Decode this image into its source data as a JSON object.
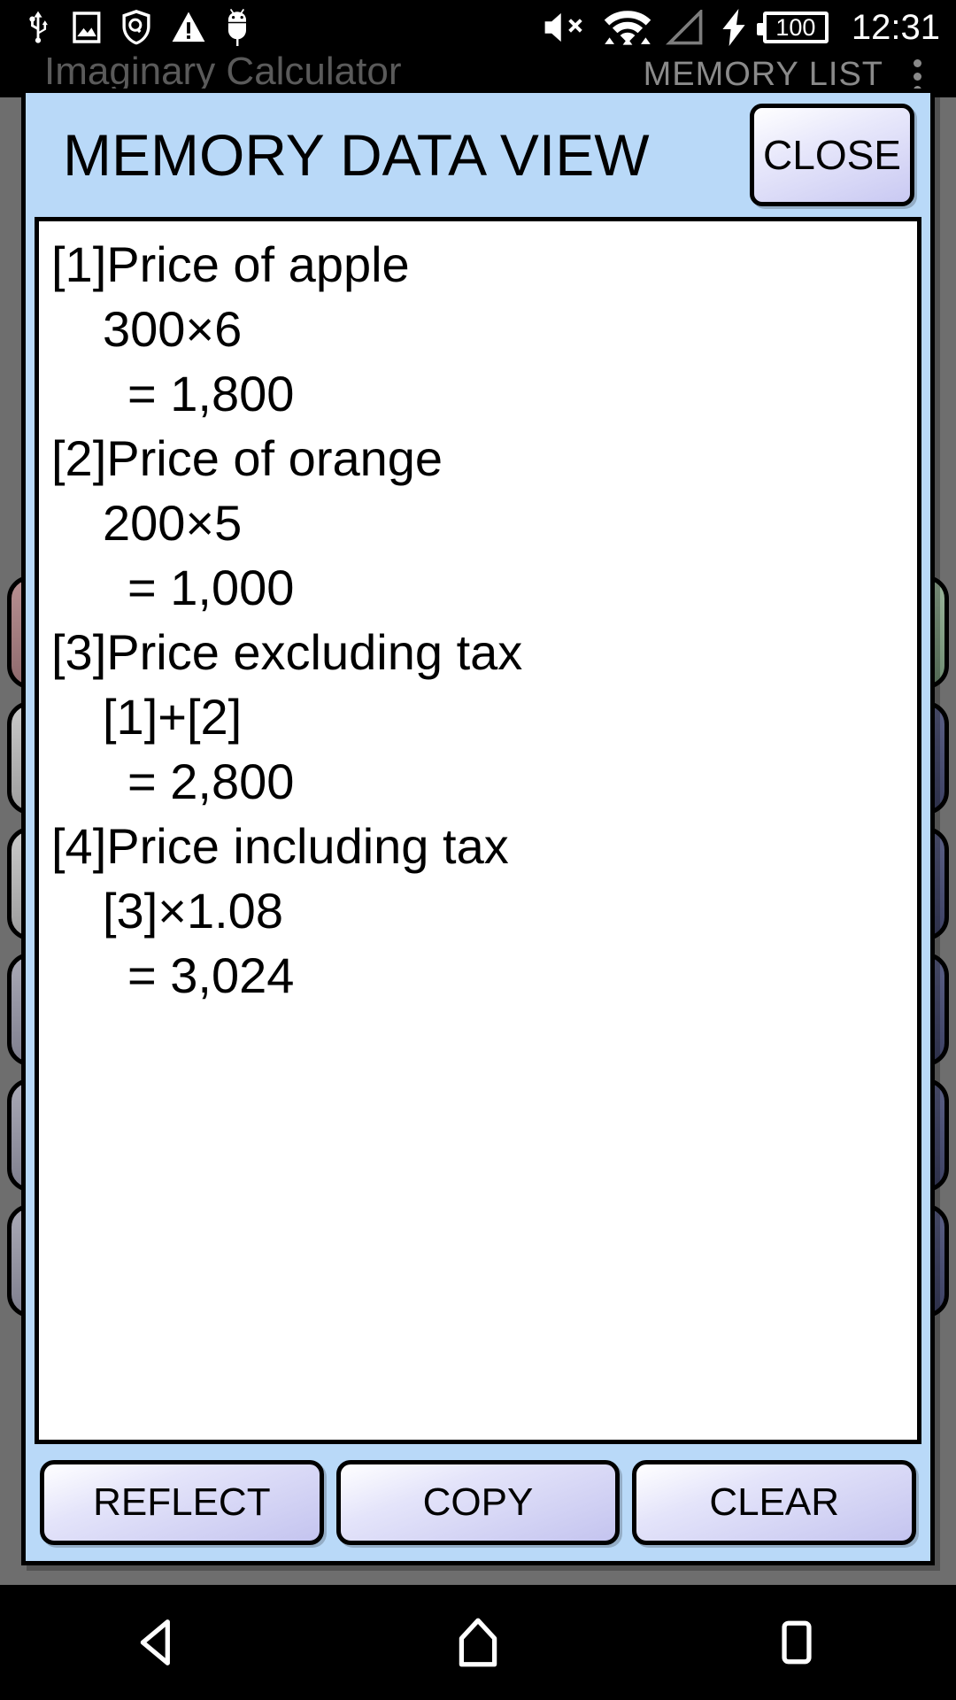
{
  "statusbar": {
    "icons_left": [
      "usb-icon",
      "image-icon",
      "security-shield-icon",
      "warning-triangle-icon",
      "android-debug-icon"
    ],
    "icons_right": [
      "volume-muted-icon",
      "wifi-icon",
      "signal-none-icon",
      "charging-bolt-icon"
    ],
    "battery_level": "100",
    "clock": "12:31"
  },
  "background_app": {
    "title": "Imaginary Calculator",
    "action_label": "MEMORY LIST",
    "overflow": "overflow-menu-icon"
  },
  "dialog": {
    "title": "MEMORY DATA VIEW",
    "close_label": "CLOSE",
    "entries": [
      {
        "label": "[1]Price of apple",
        "expr": "300×6",
        "result": "= 1,800"
      },
      {
        "label": "[2]Price of orange",
        "expr": "200×5",
        "result": "= 1,000"
      },
      {
        "label": "[3]Price excluding tax",
        "expr": "[1]+[2]",
        "result": "= 2,800"
      },
      {
        "label": "[4]Price including tax",
        "expr": "[3]×1.08",
        "result": "= 3,024"
      }
    ],
    "actions": [
      {
        "label": "REFLECT"
      },
      {
        "label": "COPY"
      },
      {
        "label": "CLEAR"
      }
    ]
  },
  "navbar": {
    "back": "back-triangle-icon",
    "home": "home-icon",
    "recents": "recents-square-icon"
  },
  "colors": {
    "dialog_header": "#b9d9f8",
    "dialog_body": "#ffffff",
    "button_face": "#c4c4ef",
    "status_bar": "#000000",
    "app_background": "#6e6e6e"
  }
}
